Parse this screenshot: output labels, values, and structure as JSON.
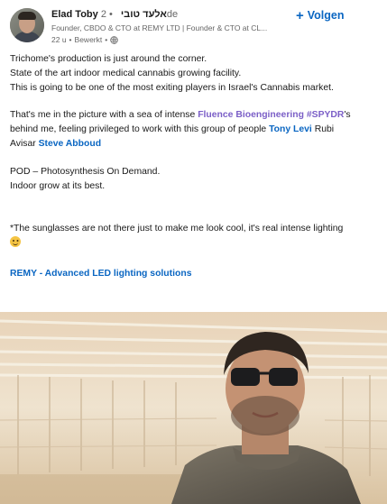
{
  "post": {
    "author": {
      "name": "Elad Toby",
      "name_hebrew": "אלעד טובי",
      "degree": "2de",
      "headline": "Founder, CBDO & CTO at REMY LTD | Founder & CTO at CL...",
      "time": "22 u",
      "edited": "Bewerkt",
      "visibility_icon": "globe-icon"
    },
    "follow_label": "Volgen",
    "text": {
      "line1": "Trichome's production is just around the corner.",
      "line2": "State of the art indoor medical cannabis growing facility.",
      "line3": "This is going to be one of the most exiting players in Israel's Cannabis market.",
      "p2_prefix": "That's me in the picture with a sea of intense ",
      "p2_mention1": "Fluence Bioengineering",
      "p2_space": " ",
      "p2_hashtag": "#SPYDR",
      "p2_mid": "'s",
      "p2_line2": "behind me, feeling privileged to work with this group of people ",
      "p2_mention2": "Tony Levi",
      "p2_after": " Rubi",
      "p2_line3_prefix": "Avisar ",
      "p2_mention3": "Steve Abboud",
      "p3_line1": "POD – Photosynthesis On Demand.",
      "p3_line2": "Indoor grow at its best.",
      "p4": "*The sunglasses are not there just to make me look cool, it's real intense lighting",
      "p4_emoji": "smiling-face-emoji",
      "link": "REMY - Advanced LED lighting solutions"
    }
  },
  "colors": {
    "link_blue": "#0a66c2",
    "mention_purple": "#7b5fc7",
    "text": "#191919",
    "muted": "#666666"
  }
}
